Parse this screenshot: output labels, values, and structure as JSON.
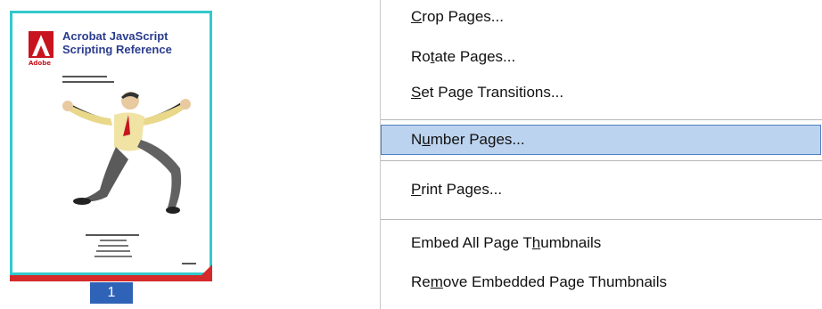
{
  "thumbnail": {
    "logo_text": "Adobe",
    "title": "Acrobat JavaScript\nScripting Reference",
    "page_number": "1",
    "colors": {
      "border": "#33c8cc",
      "selection": "#d42a2a",
      "badge": "#2f63b8",
      "title": "#2a3c8e"
    }
  },
  "menu": {
    "items": [
      {
        "pre": "",
        "mnemonic": "C",
        "post": "rop Pages..."
      },
      {
        "pre": "Ro",
        "mnemonic": "t",
        "post": "ate Pages..."
      },
      {
        "pre": "",
        "mnemonic": "S",
        "post": "et Page Transitions..."
      },
      {
        "pre": "N",
        "mnemonic": "u",
        "post": "mber Pages..."
      },
      {
        "pre": "",
        "mnemonic": "P",
        "post": "rint Pages..."
      },
      {
        "pre": "Embed All Page T",
        "mnemonic": "h",
        "post": "umbnails"
      },
      {
        "pre": "Re",
        "mnemonic": "m",
        "post": "ove Embedded Page Thumbnails"
      }
    ],
    "highlighted_index": 3,
    "colors": {
      "highlight_bg": "#bcd3ef",
      "highlight_border": "#4f7fc4"
    }
  }
}
